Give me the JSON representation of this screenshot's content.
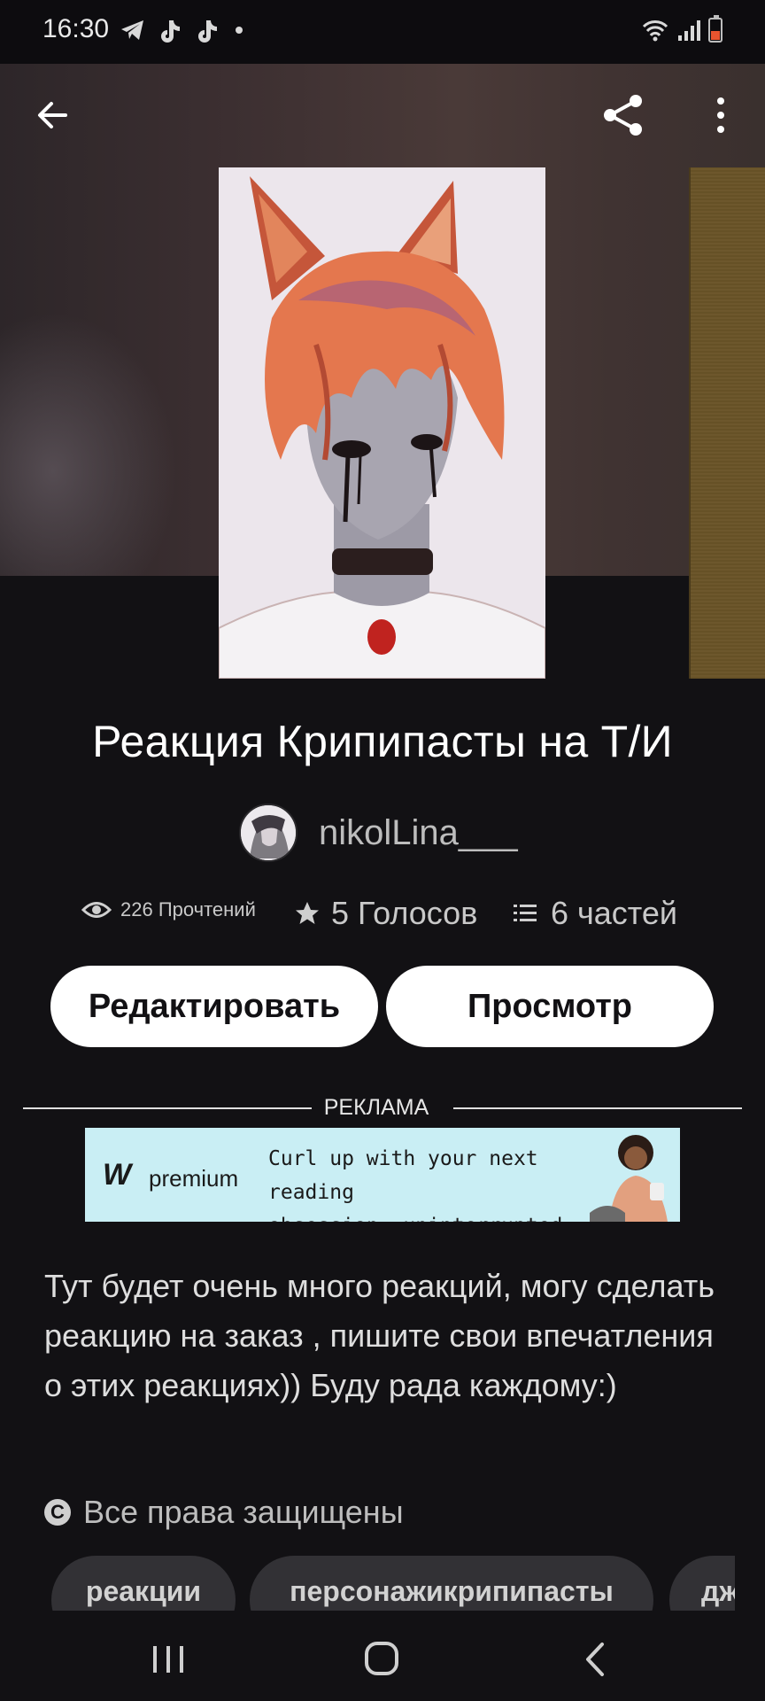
{
  "status_bar": {
    "time": "16:30",
    "icons": [
      "telegram-icon",
      "tiktok-icon",
      "tiktok-icon",
      "notification-dot-icon",
      "wifi-icon",
      "signal-icon",
      "battery-low-icon"
    ]
  },
  "header": {
    "back_icon": "arrow-left-icon",
    "share_icon": "share-icon",
    "more_icon": "more-vertical-icon"
  },
  "story": {
    "title": "Реакция Крипипасты на Т/И",
    "author": "nikolLina___",
    "reads": "226 Прочтений",
    "votes": "5 Голосов",
    "parts": "6 частей"
  },
  "actions": {
    "edit_label": "Редактировать",
    "preview_label": "Просмотр"
  },
  "ad": {
    "label": "РЕКЛАМА",
    "brand_mark": "W",
    "brand_word": "premium",
    "line1": "Curl up with your next reading",
    "line2": "obsession, uninterrupted."
  },
  "description": "Тут будет очень много реакций, могу сделать реакцию на заказ , пишите свои впечатления о этих  реакциях)) Буду рада каждому:)",
  "rights": {
    "icon_glyph": "C",
    "text": "Все права защищены"
  },
  "tags": [
    "реакции",
    "персонажикрипипасты",
    "дж"
  ],
  "colors": {
    "background": "#121114",
    "button_bg": "#ffffff",
    "tag_bg": "#323135",
    "ad_bg": "#c9eef4",
    "battery_low": "#e7542f"
  },
  "nav": [
    "recent-apps-icon",
    "home-icon",
    "back-icon"
  ]
}
